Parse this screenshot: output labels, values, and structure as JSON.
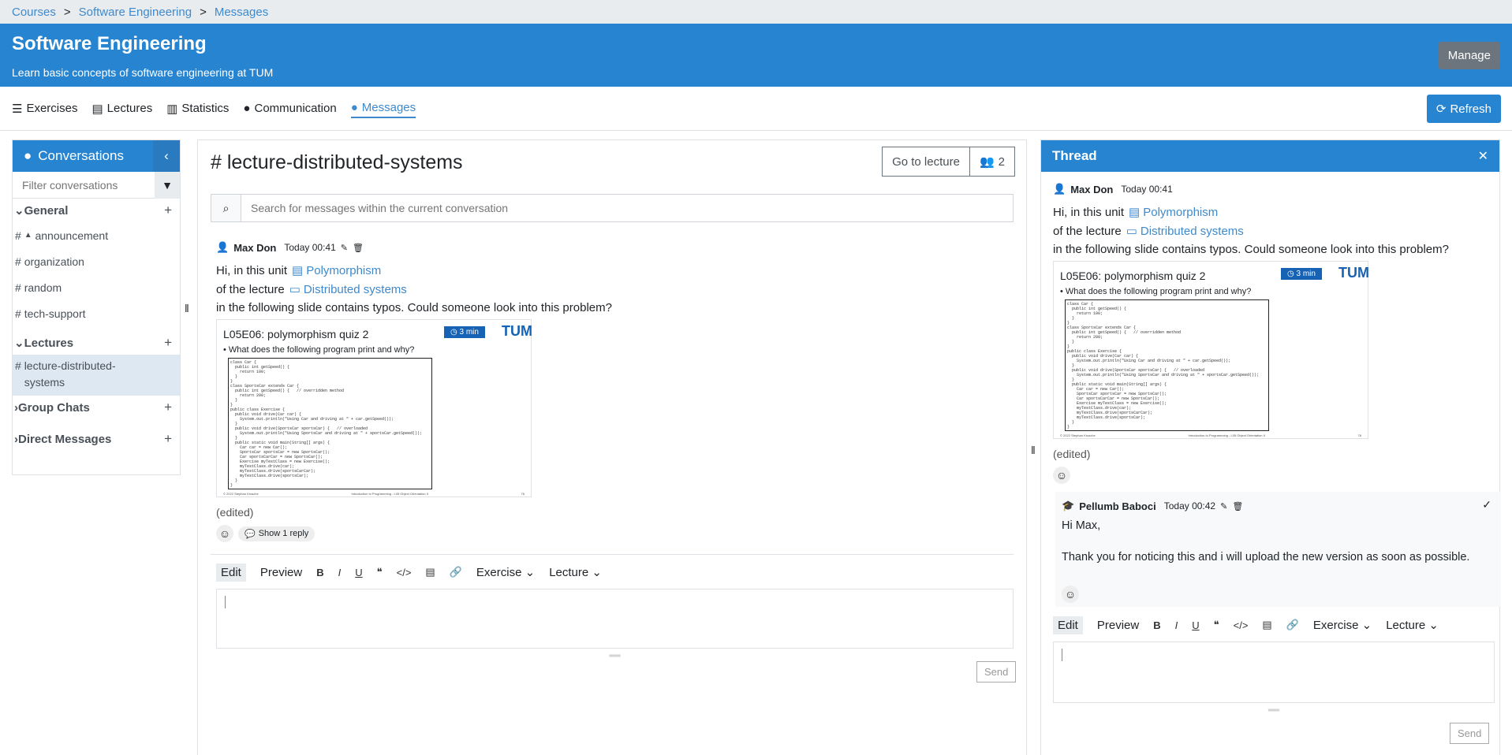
{
  "breadcrumb": [
    "Courses",
    "Software Engineering",
    "Messages"
  ],
  "header": {
    "title": "Software Engineering",
    "subtitle": "Learn basic concepts of software engineering at TUM",
    "manage_label": "Manage"
  },
  "tabs": [
    {
      "label": "Exercises"
    },
    {
      "label": "Lectures"
    },
    {
      "label": "Statistics"
    },
    {
      "label": "Communication"
    },
    {
      "label": "Messages"
    }
  ],
  "refresh_label": "Refresh",
  "sidebar": {
    "title": "Conversations",
    "filter_placeholder": "Filter conversations",
    "groups": {
      "general": "General",
      "lectures": "Lectures",
      "group_chats": "Group Chats",
      "direct_messages": "Direct Messages"
    },
    "channels": [
      "announcement",
      "organization",
      "random",
      "tech-support"
    ],
    "lecture_channel": "lecture-distributed-systems"
  },
  "main": {
    "title": "# lecture-distributed-systems",
    "go_to_lecture": "Go to lecture",
    "member_count": "2",
    "search_placeholder": "Search for messages within the current conversation",
    "message": {
      "author": "Max Don",
      "time": "Today 00:41",
      "line1_prefix": "Hi, in this unit",
      "unit_link": "Polymorphism",
      "line2_prefix": "of the lecture",
      "lecture_link": "Distributed systems",
      "line3": "in the following slide contains typos. Could someone look into this problem?",
      "edited": "(edited)",
      "show_reply": "Show 1 reply"
    },
    "editor": {
      "edit": "Edit",
      "preview": "Preview",
      "exercise": "Exercise",
      "lecture": "Lecture",
      "send": "Send"
    }
  },
  "slide": {
    "title": "L05E06: polymorphism quiz 2",
    "badge": "3 min",
    "logo": "TUM",
    "question": "What does the following program print and why?",
    "code": [
      "class Car {",
      "  public int getSpeed() {",
      "    return 100;",
      "  }",
      "}",
      "class SportsCar extends Car {",
      "  public int getSpeed() {   // overridden method",
      "    return 200;",
      "  }",
      "}",
      "public class Exercise {",
      "  public void drive(Car car) {",
      "    System.out.println(\"Using Car and driving at \" + car.getSpeed());",
      "  }",
      "  public void drive(SportsCar sportsCar) {   // overloaded",
      "    System.out.println(\"Using SportsCar and driving at \" + sportsCar.getSpeed());",
      "  }",
      "  public static void main(String[] args) {",
      "    Car car = new Car();",
      "    SportsCar sportsCar = new SportsCar();",
      "    Car sportsCarCar = new SportsCar();",
      "    Exercise myTestClass = new Exercise();",
      "    myTestClass.drive(car);",
      "    myTestClass.drive(sportsCarCar);",
      "    myTestClass.drive(sportsCar);",
      "  }",
      "}"
    ],
    "footer_left": "© 2022 Stephan Krusche",
    "footer_mid": "Introduction to Programming - L05 Object Orientation II",
    "footer_right": "76"
  },
  "thread": {
    "title": "Thread",
    "reply": {
      "author": "Pellumb Baboci",
      "time": "Today 00:42",
      "line1": "Hi Max,",
      "line2": "Thank you for noticing this and i will upload the new version as soon as possible."
    }
  }
}
